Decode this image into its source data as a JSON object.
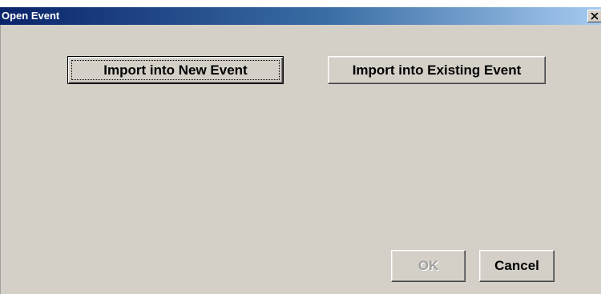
{
  "window": {
    "title": "Open Event",
    "close_icon": "close-icon"
  },
  "buttons": {
    "import_new": "Import into New Event",
    "import_existing": "Import into Existing Event",
    "ok": "OK",
    "cancel": "Cancel"
  },
  "state": {
    "default_button": "import_new",
    "ok_enabled": false
  },
  "colors": {
    "dialog_bg": "#d4d0c8",
    "title_start": "#0a246a",
    "title_end": "#a6caf0",
    "title_text": "#ffffff",
    "disabled_text": "#a0a0a0"
  }
}
